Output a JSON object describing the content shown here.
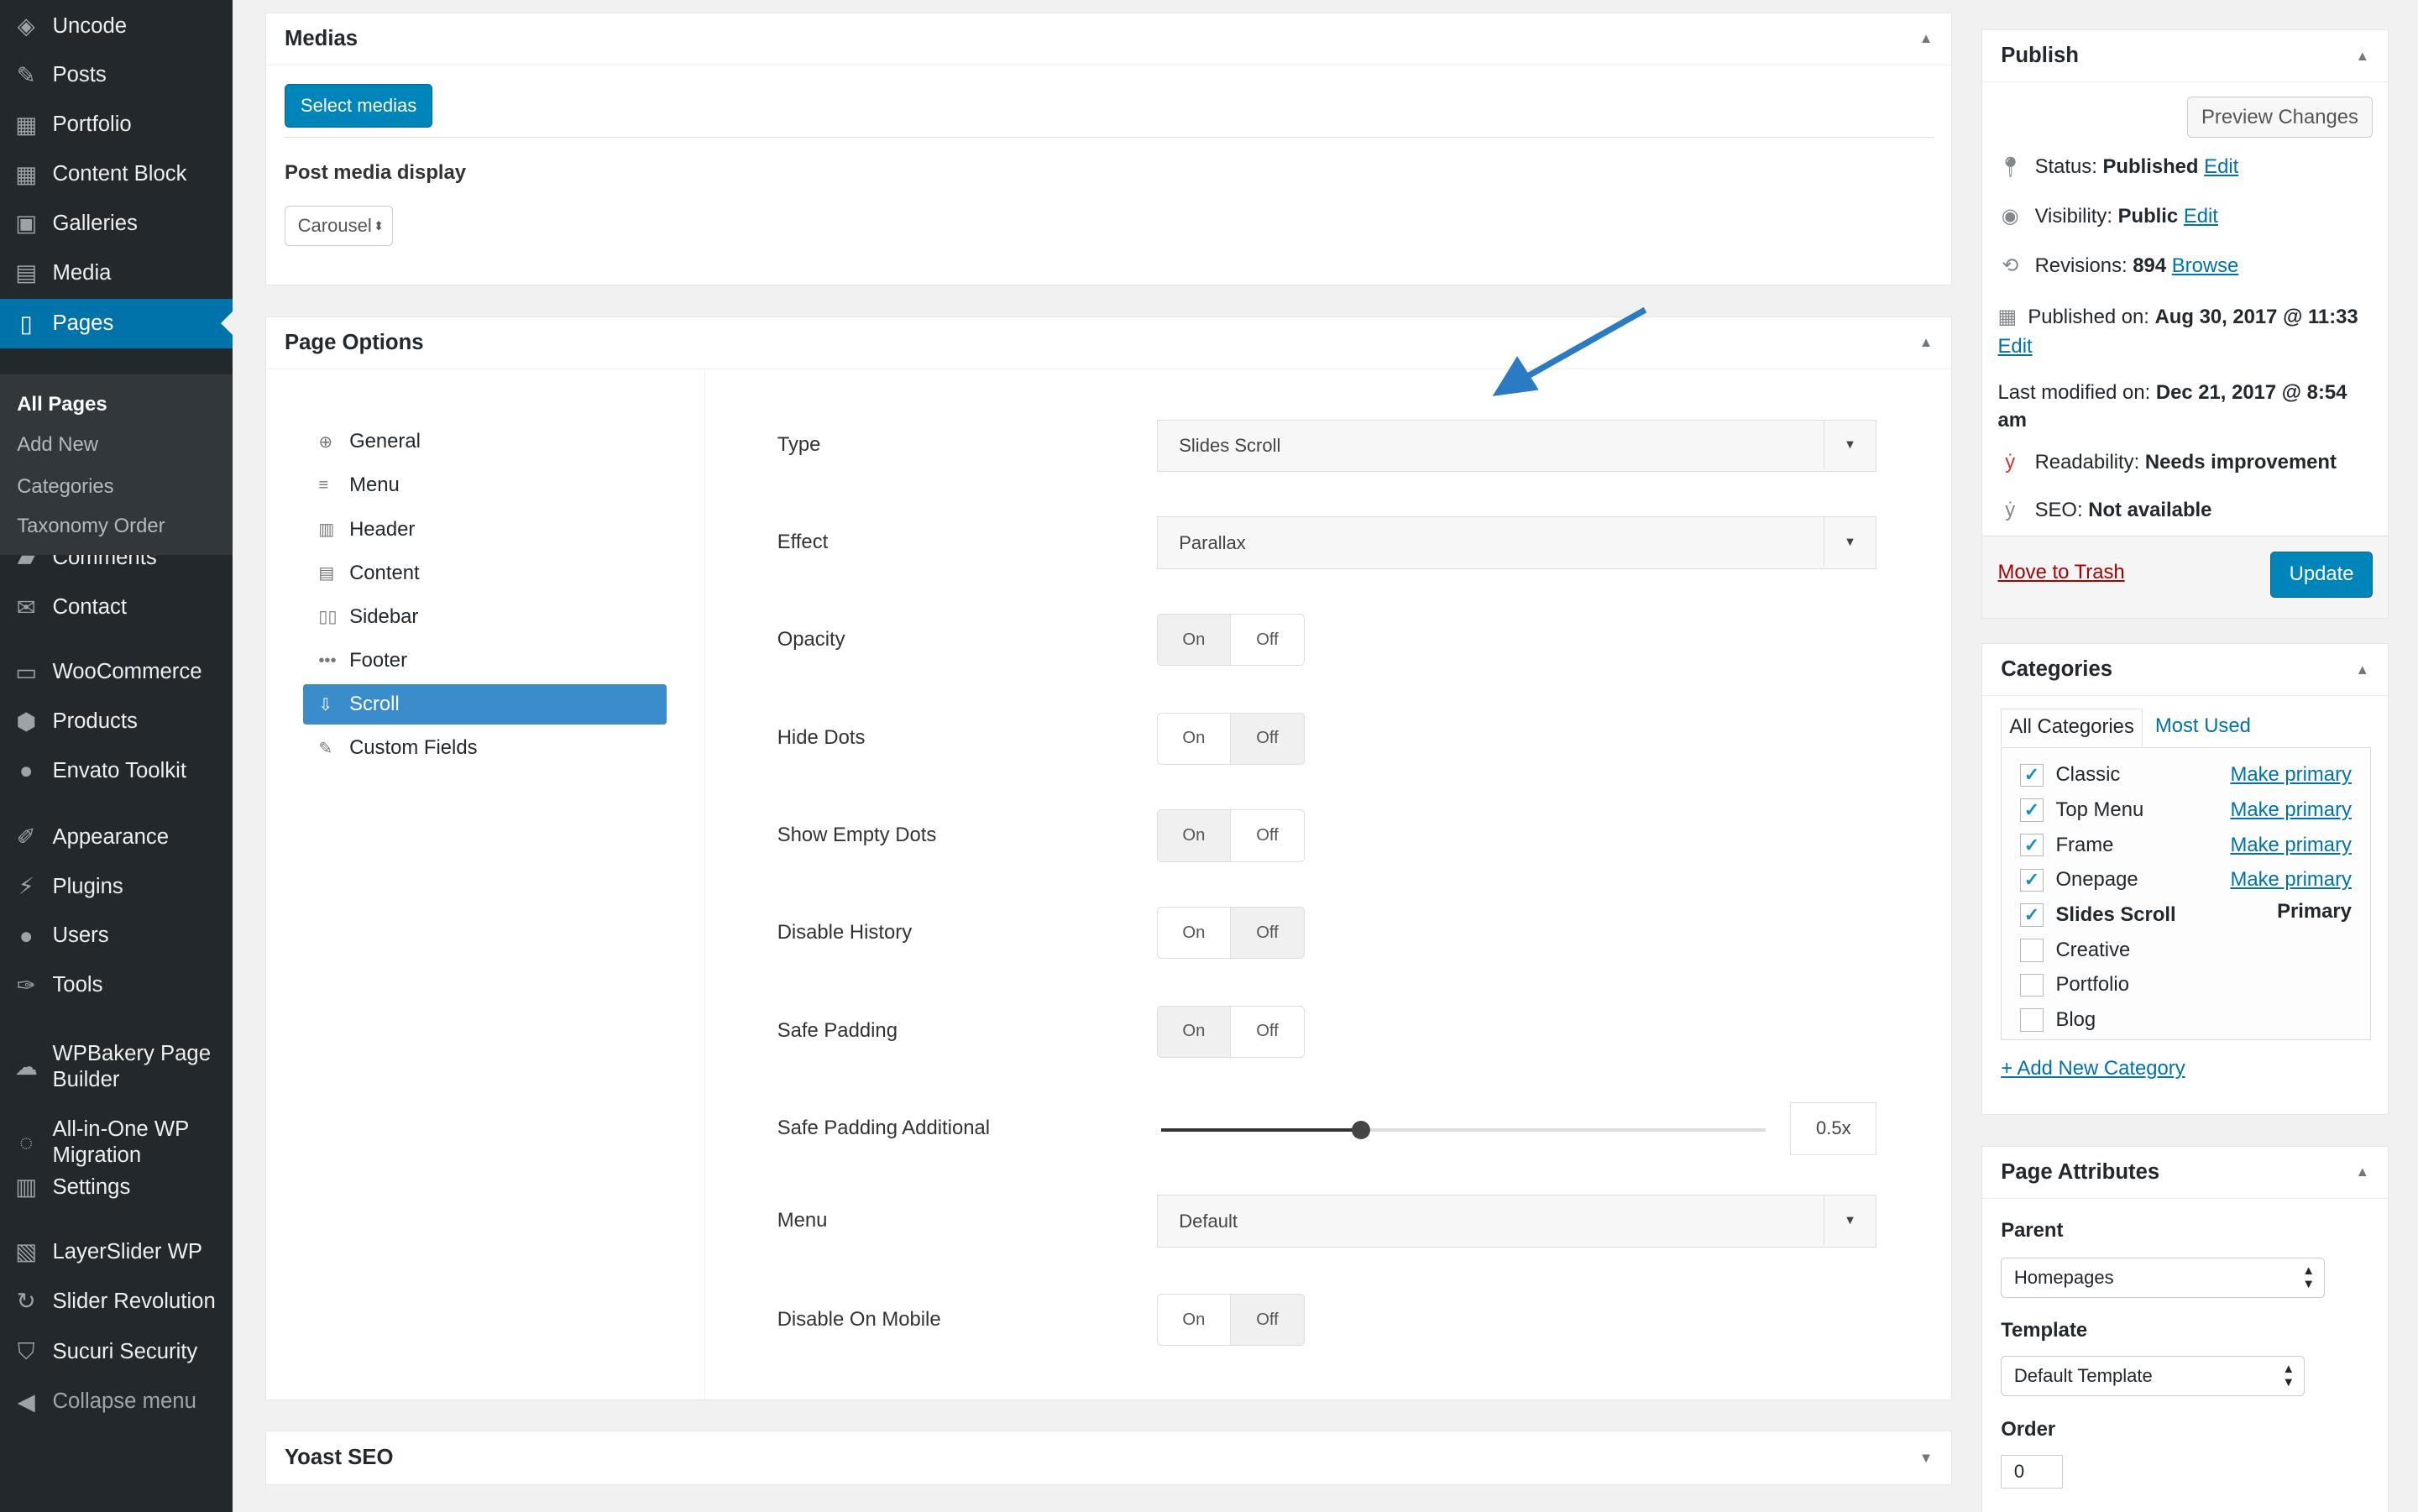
{
  "sidebar": {
    "items": [
      {
        "label": "Uncode",
        "icon": "layers-icon"
      },
      {
        "label": "Posts",
        "icon": "pin-icon"
      },
      {
        "label": "Portfolio",
        "icon": "grid-icon"
      },
      {
        "label": "Content Block",
        "icon": "grid-icon"
      },
      {
        "label": "Galleries",
        "icon": "gallery-icon"
      },
      {
        "label": "Media",
        "icon": "media-icon"
      },
      {
        "label": "Pages",
        "icon": "pages-icon"
      },
      {
        "label": "Comments",
        "icon": "comment-icon"
      },
      {
        "label": "Contact",
        "icon": "mail-icon"
      },
      {
        "label": "WooCommerce",
        "icon": "woo-icon"
      },
      {
        "label": "Products",
        "icon": "box-icon"
      },
      {
        "label": "Envato Toolkit",
        "icon": "leaf-icon"
      },
      {
        "label": "Appearance",
        "icon": "brush-icon"
      },
      {
        "label": "Plugins",
        "icon": "plug-icon"
      },
      {
        "label": "Users",
        "icon": "user-icon"
      },
      {
        "label": "Tools",
        "icon": "wrench-icon"
      },
      {
        "label": "WPBakery Page Builder",
        "icon": "cloud-icon"
      },
      {
        "label": "All-in-One WP Migration",
        "icon": "sync-icon"
      },
      {
        "label": "Settings",
        "icon": "settings-icon"
      },
      {
        "label": "LayerSlider WP",
        "icon": "slides-icon"
      },
      {
        "label": "Slider Revolution",
        "icon": "refresh-icon"
      },
      {
        "label": "Sucuri Security",
        "icon": "shield-icon"
      },
      {
        "label": "Collapse menu",
        "icon": "collapse-icon"
      }
    ],
    "submenu": [
      "All Pages",
      "Add New",
      "Categories",
      "Taxonomy Order"
    ]
  },
  "medias": {
    "title": "Medias",
    "select_button": "Select medias",
    "display_label": "Post media display",
    "display_value": "Carousel"
  },
  "page_options": {
    "title": "Page Options",
    "nav": [
      "General",
      "Menu",
      "Header",
      "Content",
      "Sidebar",
      "Footer",
      "Scroll",
      "Custom Fields"
    ],
    "fields": {
      "type_label": "Type",
      "type_value": "Slides Scroll",
      "effect_label": "Effect",
      "effect_value": "Parallax",
      "opacity": "Opacity",
      "hide_dots": "Hide Dots",
      "show_empty_dots": "Show Empty Dots",
      "disable_history": "Disable History",
      "safe_padding": "Safe Padding",
      "safe_padding_additional": "Safe Padding Additional",
      "safe_padding_value": "0.5x",
      "slider_fraction": 0.33,
      "menu_label": "Menu",
      "menu_value": "Default",
      "disable_mobile": "Disable On Mobile"
    },
    "toggle_on": "On",
    "toggle_off": "Off",
    "toggles": {
      "opacity": "on",
      "hide_dots": "off",
      "show_empty_dots": "on",
      "disable_history": "off",
      "safe_padding": "on",
      "disable_mobile": "off"
    }
  },
  "yoast": {
    "title": "Yoast SEO"
  },
  "publish": {
    "title": "Publish",
    "preview": "Preview Changes",
    "status_label": "Status:",
    "status": "Published",
    "visibility_label": "Visibility:",
    "visibility": "Public",
    "revisions_label": "Revisions:",
    "revisions": "894",
    "browse": "Browse",
    "published_label": "Published on:",
    "published": "Aug 30, 2017 @ 11:33",
    "edit": "Edit",
    "modified_label": "Last modified on:",
    "modified": "Dec 21, 2017 @ 8:54 am",
    "readability_label": "Readability:",
    "readability": "Needs improvement",
    "seo_label": "SEO:",
    "seo": "Not available",
    "trash": "Move to Trash",
    "update": "Update"
  },
  "categories": {
    "title": "Categories",
    "tab_all": "All Categories",
    "tab_used": "Most Used",
    "make_primary": "Make primary",
    "primary": "Primary",
    "add_new": "+ Add New Category",
    "items": [
      {
        "name": "Classic",
        "checked": true
      },
      {
        "name": "Top Menu",
        "checked": true
      },
      {
        "name": "Frame",
        "checked": true
      },
      {
        "name": "Onepage",
        "checked": true
      },
      {
        "name": "Slides Scroll",
        "checked": true
      },
      {
        "name": "Creative",
        "checked": false
      },
      {
        "name": "Portfolio",
        "checked": false
      },
      {
        "name": "Blog",
        "checked": false
      }
    ]
  },
  "attributes": {
    "title": "Page Attributes",
    "parent_label": "Parent",
    "parent": "Homepages",
    "template_label": "Template",
    "template": "Default Template",
    "order_label": "Order",
    "order": "0"
  },
  "colors": {
    "accent": "#0073aa",
    "sidebar": "#23282d",
    "arrow": "#2b7bc4"
  }
}
